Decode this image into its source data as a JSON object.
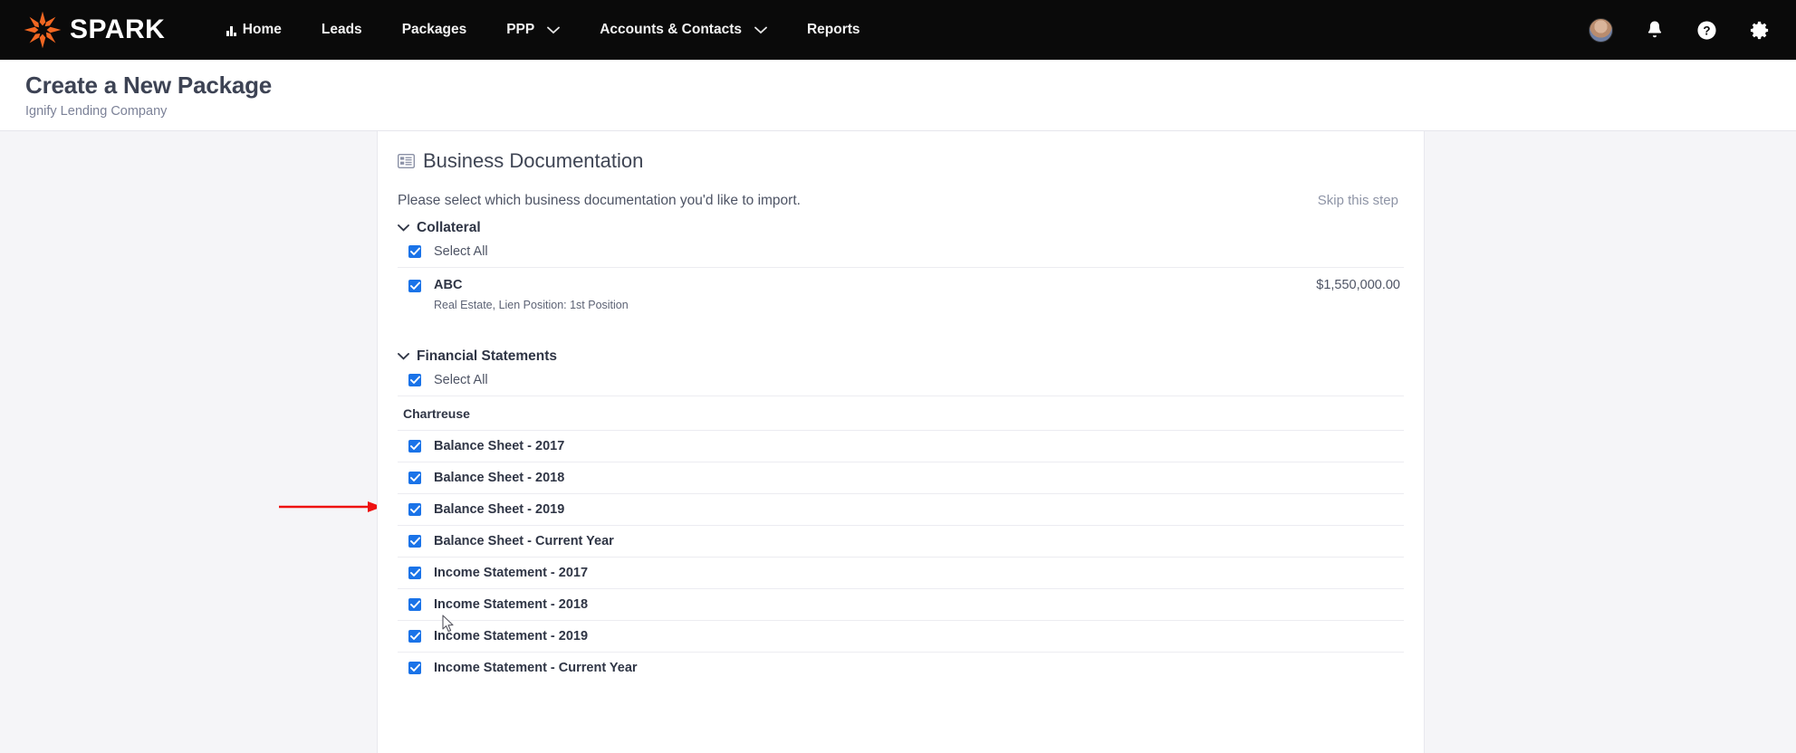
{
  "navbar": {
    "brand": "SPARK",
    "logo_icon": "spark-starburst-icon",
    "links": [
      {
        "label": "Home",
        "icon": "analytics-bars-icon",
        "has_chevron": false
      },
      {
        "label": "Leads",
        "icon": "",
        "has_chevron": false
      },
      {
        "label": "Packages",
        "icon": "",
        "has_chevron": false
      },
      {
        "label": "PPP",
        "icon": "",
        "has_chevron": true
      },
      {
        "label": "Accounts & Contacts",
        "icon": "",
        "has_chevron": true
      },
      {
        "label": "Reports",
        "icon": "",
        "has_chevron": false
      }
    ],
    "right_icons": [
      "user-avatar",
      "bell-icon",
      "help-icon",
      "gear-icon"
    ],
    "background": "#0a0a0a"
  },
  "header": {
    "title": "Create a New Package",
    "subtitle": "Ignify Lending Company"
  },
  "card": {
    "icon": "document-list-icon",
    "title": "Business Documentation",
    "instruction": "Please select which business documentation you'd like to import.",
    "skip_label": "Skip this step",
    "collateral": {
      "group_label": "Collateral",
      "select_all_label": "Select All",
      "select_all_checked": true,
      "items": [
        {
          "name": "ABC",
          "detail": "Real Estate, Lien Position: 1st Position",
          "amount": "$1,550,000.00",
          "checked": true
        }
      ]
    },
    "financial_statements": {
      "group_label": "Financial Statements",
      "select_all_label": "Select All",
      "select_all_checked": true,
      "subgroup_label": "Chartreuse",
      "items": [
        {
          "label": "Balance Sheet - 2017",
          "checked": true
        },
        {
          "label": "Balance Sheet - 2018",
          "checked": true
        },
        {
          "label": "Balance Sheet - 2019",
          "checked": true
        },
        {
          "label": "Balance Sheet - Current Year",
          "checked": true
        },
        {
          "label": "Income Statement - 2017",
          "checked": true
        },
        {
          "label": "Income Statement - 2018",
          "checked": true
        },
        {
          "label": "Income Statement - 2019",
          "checked": true
        },
        {
          "label": "Income Statement - Current Year",
          "checked": true
        }
      ]
    }
  },
  "annotation": {
    "arrow_color": "#ee1111",
    "points_to": "Financial Statements"
  },
  "colors": {
    "accent_orange": "#f26722",
    "checkbox_blue": "#1a73e8",
    "nav_background": "#0a0a0a",
    "page_background": "#f5f5f8"
  }
}
